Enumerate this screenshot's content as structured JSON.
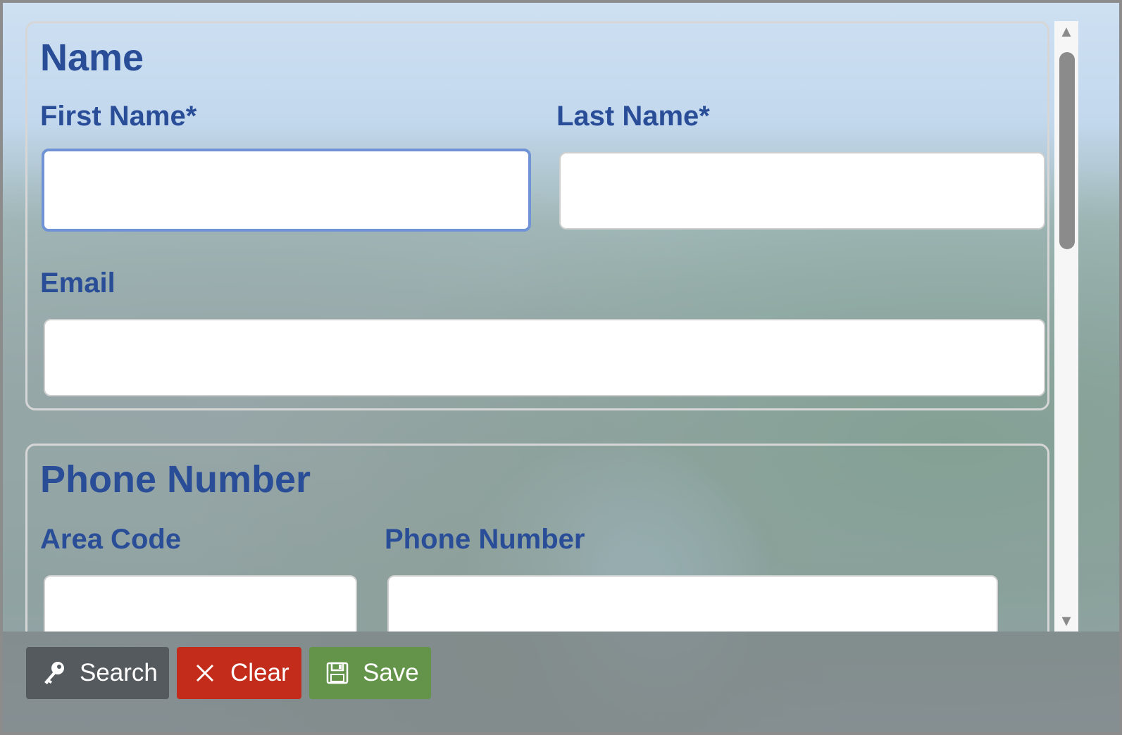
{
  "name_section": {
    "heading": "Name",
    "first_name_label": "First Name*",
    "first_name_value": "",
    "last_name_label": "Last Name*",
    "last_name_value": "",
    "email_label": "Email",
    "email_value": ""
  },
  "phone_section": {
    "heading": "Phone Number",
    "area_code_label": "Area Code",
    "area_code_value": "",
    "phone_number_label": "Phone Number",
    "phone_number_value": ""
  },
  "toolbar": {
    "search_label": "Search",
    "clear_label": "Clear",
    "save_label": "Save"
  },
  "icons": {
    "search": "key-icon",
    "clear": "close-icon",
    "save": "floppy-disk-icon",
    "scroll_up": "triangle-up-icon",
    "scroll_down": "triangle-down-icon"
  },
  "colors": {
    "label_text": "#2a4d98",
    "search_button": "#555a5f",
    "clear_button": "#c32c1b",
    "save_button": "#63944a",
    "focus_border": "#6f93d4"
  }
}
